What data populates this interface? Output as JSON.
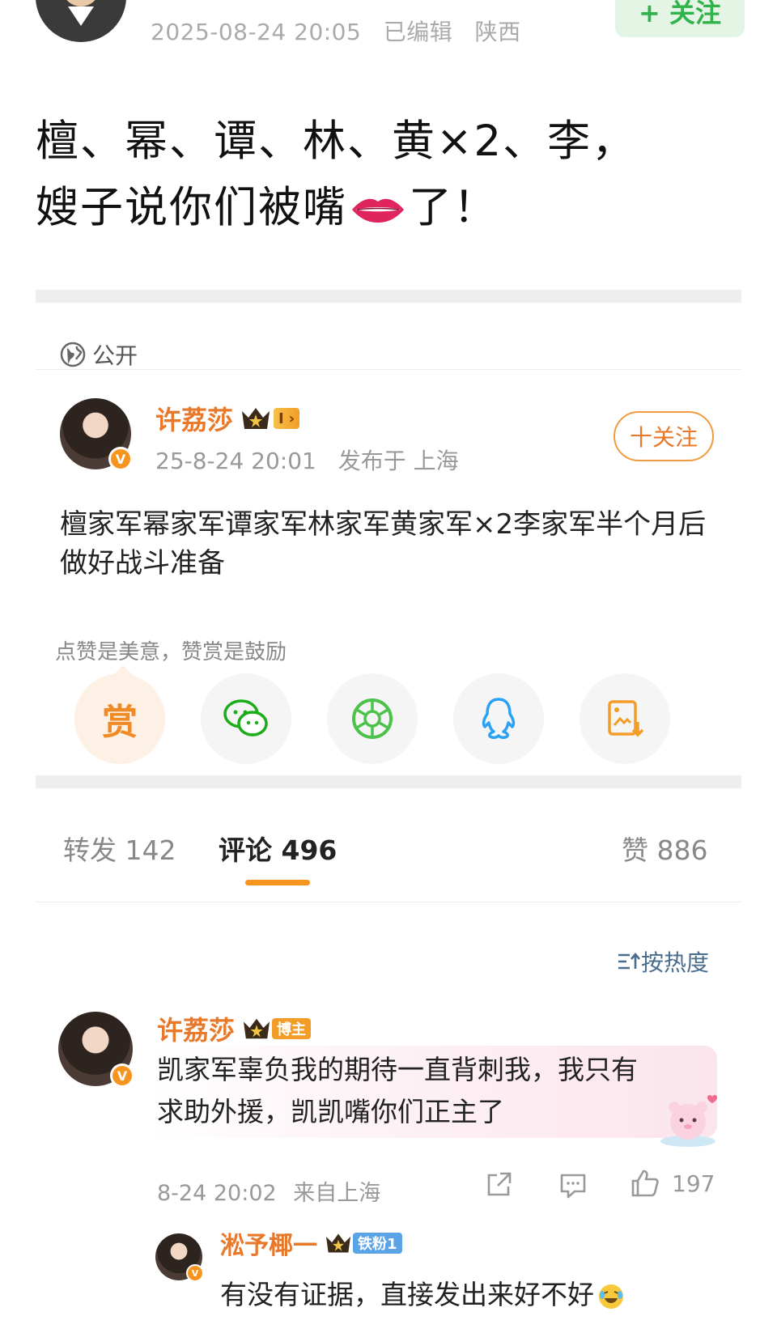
{
  "header": {
    "timestamp": "2025-08-24 20:05",
    "edited": "已编辑",
    "location": "陕西",
    "follow_label": "+ 关注"
  },
  "post": {
    "line1": "檀、幂、谭、林、黄×2、李，",
    "line2_before": "嫂子说你们被嘴",
    "line2_emoji": "lips-emoji",
    "line2_after": "了！"
  },
  "visibility": {
    "icon": "globe-icon",
    "label": "公开"
  },
  "quoted": {
    "author": "许荔莎",
    "level_badge": "I",
    "time": "25-8-24 20:01",
    "source": "发布于 上海",
    "follow_label": "十关注",
    "text": "檀家军幂家军谭家军林家军黄家军×2李家军半个月后做好战斗准备",
    "hint": "点赞是美意，赞赏是鼓励",
    "share_targets": [
      {
        "name": "reward",
        "label": "赏"
      },
      {
        "name": "wechat-icon"
      },
      {
        "name": "moments-icon"
      },
      {
        "name": "qq-icon"
      },
      {
        "name": "save-image-icon"
      }
    ]
  },
  "tabs": {
    "repost": "转发 142",
    "comments": "评论 496",
    "likes": "赞 886"
  },
  "sort_label": "按热度",
  "comment": {
    "author": "许荔莎",
    "badge": "博主",
    "text_line1": "凯家军辜负我的期待一直背刺我，我只有",
    "text_line2": "求助外援，凯凯嘴你们正主了",
    "time": "8-24 20:02",
    "source": "来自上海",
    "like_count": "197"
  },
  "reply": {
    "author": "淞予椰一",
    "badge": "铁粉1",
    "text": "有没有证据，直接发出来好不好"
  },
  "colors": {
    "accent": "#f7941d",
    "name": "#e8782a",
    "follow_green": "#2fb34a",
    "link": "#4a6c8e"
  }
}
